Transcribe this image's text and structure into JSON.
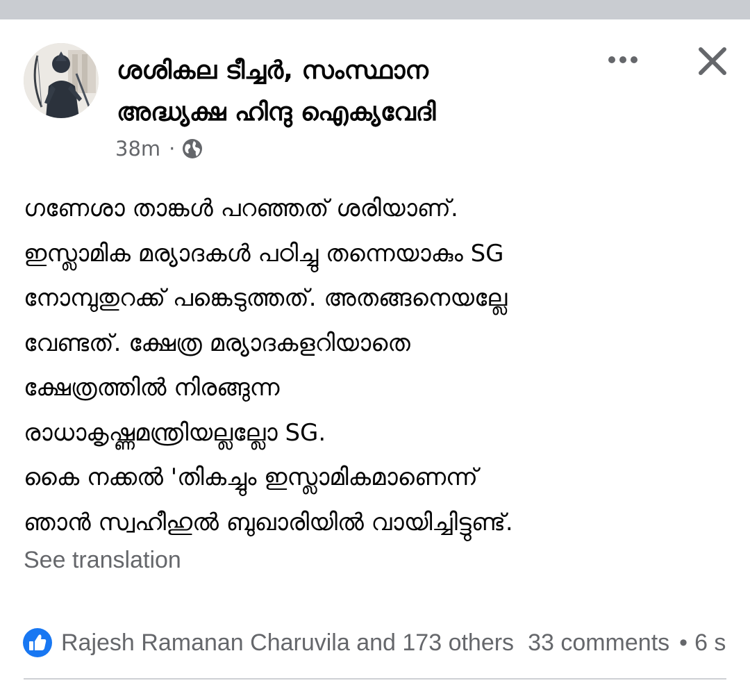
{
  "post": {
    "author_line1": "ശശികല ടീച്ചർ, സംസ്ഥാന",
    "author_line2": "അദ്ധ്യക്ഷ ഹിന്ദു ഐക്യവേദി",
    "timestamp": "38m",
    "dot": "·",
    "privacy_icon": "globe-icon",
    "more_icon": "more-horizontal-icon",
    "close_icon": "close-icon",
    "body_lines": [
      "ഗണേശാ താങ്കൾ  പറഞ്ഞത് ശരിയാണ്.",
      "ഇസ്ലാമിക മര്യാദകൾ പഠിച്ചു തന്നെയാകും SG",
      "നോമ്പുതുറക്ക് പങ്കെടുത്തത്. അതങ്ങനെയല്ലേ",
      "വേണ്ടത്. ക്ഷേത്ര മര്യാദകളറിയാതെ",
      "ക്ഷേത്രത്തിൽ നിരങ്ങുന്ന",
      "രാധാകൃഷ്ണമന്ത്രിയല്ലല്ലോ SG.",
      "കൈ  നക്കൽ 'തികച്ചും ഇസ്ലാമികമാണെന്ന്",
      "ഞാൻ സ്വഹീഹുൽ ബുഖാരിയിൽ വായിച്ചിട്ടുണ്ട്."
    ],
    "see_translation": "See translation"
  },
  "footer": {
    "reaction_icon": "like-icon",
    "reactions": "Rajesh Ramanan Charuvila and 173 others",
    "comments": "33 comments",
    "separator": "•",
    "shares": "6 s"
  },
  "colors": {
    "like_blue": "#1877f2",
    "secondary_text": "#65676b",
    "primary_text": "#050505",
    "top_strip": "#c9ccd1"
  }
}
